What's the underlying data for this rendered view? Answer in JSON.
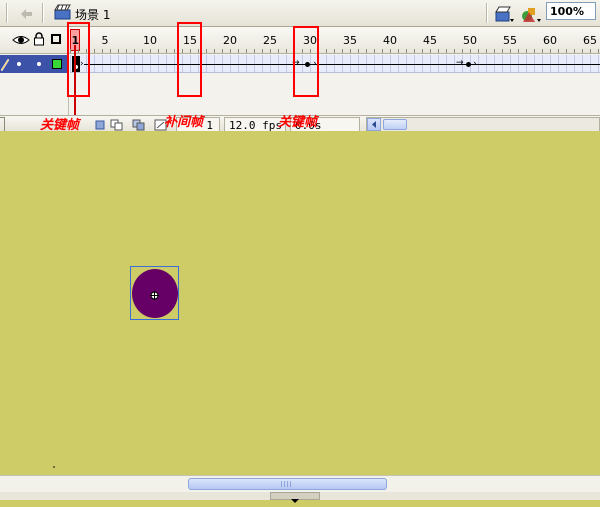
{
  "scene": {
    "label": "场景 1",
    "zoom": "100%"
  },
  "icons": {
    "back": "arrow-left-icon",
    "scene": "clapperboard-icon",
    "edit_scene": "edit-scene-icon",
    "edit_symbol": "edit-symbol-icon",
    "eye": "eye-icon",
    "lock": "lock-icon",
    "outline": "outline-square-icon",
    "pencil": "pencil-icon"
  },
  "timeline": {
    "frame_numbers": [
      "1",
      "5",
      "10",
      "15",
      "20",
      "25",
      "30",
      "35",
      "40",
      "45",
      "50",
      "55",
      "60",
      "65"
    ],
    "current_frame": "1",
    "frame_rate": "12.0 fps",
    "elapsed": "0.0s",
    "elapsed_partial": "0.0s"
  },
  "annotations": {
    "keyframe_left": "关键帧",
    "tween_frames": "补间帧",
    "keyframe_right": "关键帧"
  },
  "colors": {
    "stage": "#cdcc66",
    "circle_fill": "#660066",
    "annotation": "#ff0000",
    "layer_highlight": "#3b52a8"
  }
}
